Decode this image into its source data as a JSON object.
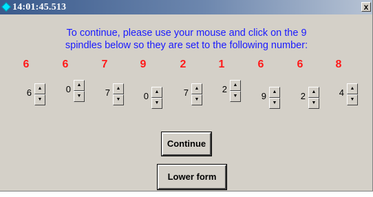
{
  "window": {
    "title": "14:01:45.513",
    "close_label": "x"
  },
  "instructions": {
    "line1": "To continue, please use your mouse and click on the 9",
    "line2": "spindles below so they are set to the following number:"
  },
  "targets": [
    "6",
    "6",
    "7",
    "9",
    "2",
    "1",
    "6",
    "6",
    "8"
  ],
  "spindles": [
    {
      "value": "6"
    },
    {
      "value": "0"
    },
    {
      "value": "7"
    },
    {
      "value": "0"
    },
    {
      "value": "7"
    },
    {
      "value": "2"
    },
    {
      "value": "9"
    },
    {
      "value": "2"
    },
    {
      "value": "4"
    }
  ],
  "spin_up_glyph": "▲",
  "spin_down_glyph": "▼",
  "buttons": {
    "continue": "Continue",
    "lower": "Lower form"
  },
  "colors": {
    "instruction": "#1a1aff",
    "target": "#ff1a1a",
    "window_bg": "#d4d0c8"
  }
}
